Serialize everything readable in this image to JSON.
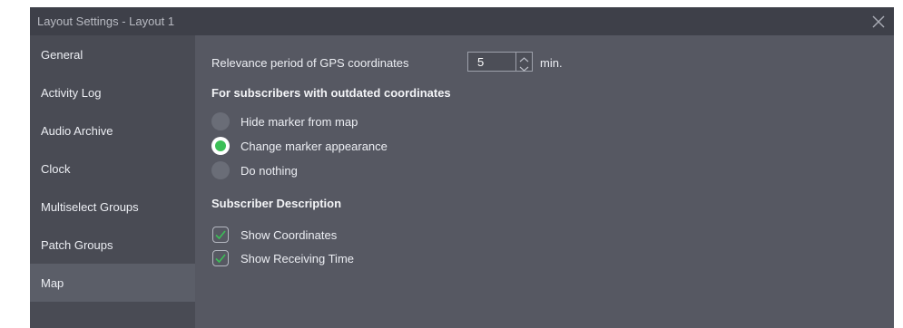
{
  "window": {
    "title": "Layout Settings - Layout 1"
  },
  "sidebar": {
    "items": [
      {
        "label": "General"
      },
      {
        "label": "Activity Log"
      },
      {
        "label": "Audio Archive"
      },
      {
        "label": "Clock"
      },
      {
        "label": "Multiselect Groups"
      },
      {
        "label": "Patch Groups"
      },
      {
        "label": "Map",
        "selected": true
      }
    ]
  },
  "map_settings": {
    "relevance_label": "Relevance period of GPS coordinates",
    "relevance_value": "5",
    "relevance_unit": "min.",
    "outdated_heading": "For subscribers with outdated coordinates",
    "outdated_options": [
      {
        "label": "Hide marker from map",
        "checked": false
      },
      {
        "label": "Change marker appearance",
        "checked": true
      },
      {
        "label": "Do nothing",
        "checked": false
      }
    ],
    "description_heading": "Subscriber Description",
    "description_options": [
      {
        "label": "Show Coordinates",
        "checked": true
      },
      {
        "label": "Show Receiving Time",
        "checked": true
      }
    ]
  },
  "colors": {
    "accent_green": "#3cbf57",
    "window_bg": "#565862",
    "sidebar_bg": "#494b54",
    "titlebar_bg": "#3e4049"
  },
  "icons": {
    "close": "close-icon",
    "spin_up": "chevron-up-icon",
    "spin_down": "chevron-down-icon",
    "check": "checkmark-icon"
  }
}
